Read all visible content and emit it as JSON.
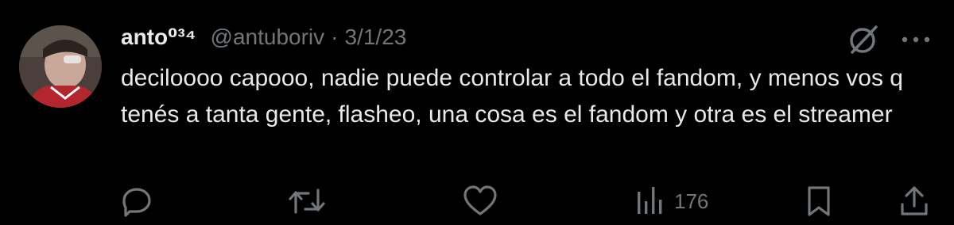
{
  "tweet": {
    "display_name": "anto⁰³⁴",
    "handle": "@antuboriv",
    "separator": "·",
    "date": "3/1/23",
    "text": "deciloooo capooo, nadie puede controlar a todo el fandom, y menos vos q tenés a tanta gente, flasheo, una cosa es el fandom y otra es el streamer",
    "views": "176"
  },
  "icons": {
    "avatar": "user-avatar-photo",
    "grok": "grok-icon",
    "more": "more-horizontal-icon",
    "reply": "reply-icon",
    "retweet": "retweet-icon",
    "like": "heart-icon",
    "views": "views-bar-chart-icon",
    "bookmark": "bookmark-icon",
    "share": "share-icon"
  },
  "colors": {
    "background": "#000000",
    "primary_text": "#e7e9ea",
    "secondary_text": "#71767b"
  }
}
